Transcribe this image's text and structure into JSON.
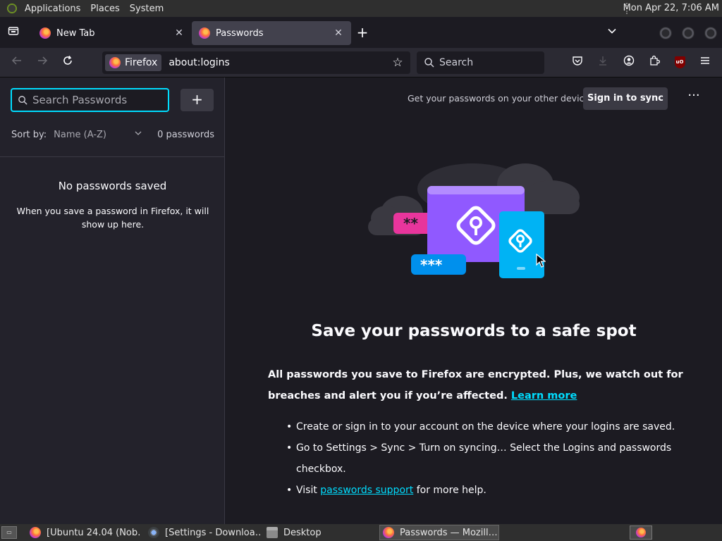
{
  "top_panel": {
    "menus": [
      "Applications",
      "Places",
      "System"
    ],
    "clock": "Mon Apr 22,  7:06 AM"
  },
  "tabs": [
    {
      "title": "New Tab",
      "active": false
    },
    {
      "title": "Passwords",
      "active": true
    }
  ],
  "navbar": {
    "identity_label": "Firefox",
    "url": "about:logins",
    "search_placeholder": "Search"
  },
  "sidebar": {
    "search_placeholder": "Search Passwords",
    "add_label": "+",
    "sort_label": "Sort by:",
    "sort_value": "Name (A-Z)",
    "count": "0 passwords",
    "empty_title": "No passwords saved",
    "empty_desc": "When you save a password in Firefox, it will show up here."
  },
  "main": {
    "sync_text": "Get your passwords on your other devices",
    "sync_button": "Sign in to sync",
    "more_label": "···",
    "headline": "Save your passwords to a safe spot",
    "intro": "All passwords you save to Firefox are encrypted. Plus, we watch out for breaches and alert you if you’re affected.",
    "learn_more": "Learn more",
    "steps": {
      "step1": "Create or sign in to your account on the device where your logins are saved.",
      "step2": "Go to Settings > Sync > Turn on syncing… Select the Logins and passwords checkbox.",
      "step3_pre": "Visit",
      "step3_link": "passwords support",
      "step3_post": "for more help."
    },
    "illustration": {
      "pw_short": "**",
      "pw_long": "***"
    }
  },
  "taskbar": {
    "tasks": [
      {
        "label": "[Ubuntu 24.04 (Nob…",
        "icon": "firefox-icon"
      },
      {
        "label": "[Settings - Downloa…",
        "icon": "chrome-icon"
      },
      {
        "label": "Desktop",
        "icon": "folder-icon"
      },
      {
        "label": "Passwords — Mozill…",
        "icon": "firefox-icon"
      }
    ]
  },
  "colors": {
    "accent": "#00ddff",
    "background": "#1c1b22",
    "sidebar": "#23222b",
    "toolbar": "#2b2a33"
  }
}
